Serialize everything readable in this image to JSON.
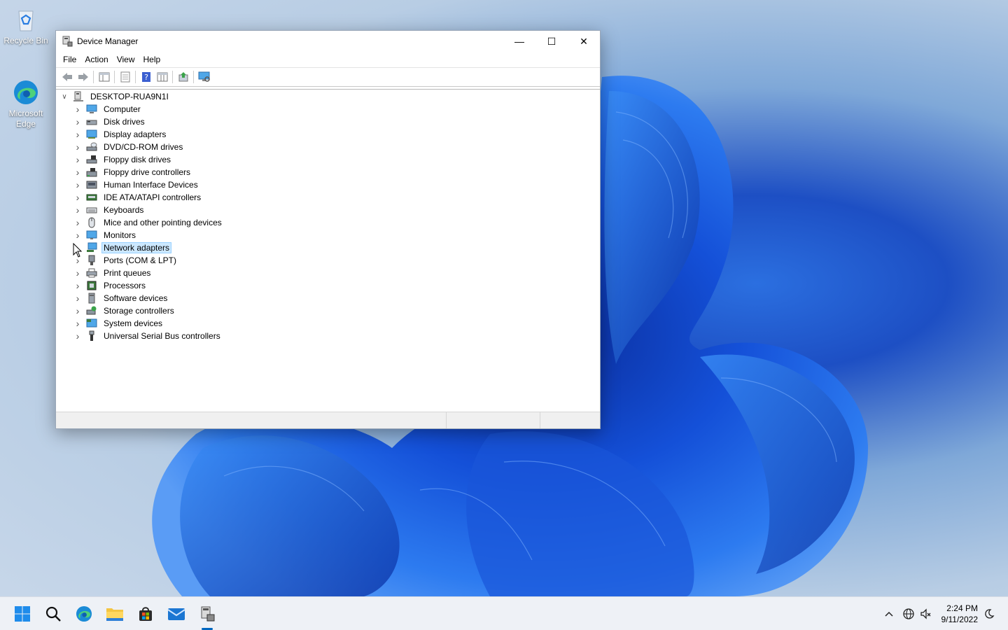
{
  "desktop": {
    "icons": [
      {
        "label": "Recycle Bin",
        "icon": "recycle-bin-icon"
      },
      {
        "label": "Microsoft Edge",
        "icon": "edge-icon"
      }
    ]
  },
  "window": {
    "title": "Device Manager",
    "controls": {
      "minimize": "—",
      "maximize": "☐",
      "close": "✕"
    },
    "menu": [
      "File",
      "Action",
      "View",
      "Help"
    ],
    "toolbar": [
      "back-icon",
      "forward-icon",
      "show-hide-console-tree-icon",
      "properties-icon",
      "help-icon",
      "console-tree-view-icon",
      "update-driver-icon",
      "scan-hardware-icon"
    ],
    "tree": {
      "root": "DESKTOP-RUA9N1I",
      "items": [
        {
          "label": "Computer",
          "icon": "computer-icon"
        },
        {
          "label": "Disk drives",
          "icon": "disk-drive-icon"
        },
        {
          "label": "Display adapters",
          "icon": "display-adapter-icon"
        },
        {
          "label": "DVD/CD-ROM drives",
          "icon": "dvd-drive-icon"
        },
        {
          "label": "Floppy disk drives",
          "icon": "floppy-disk-icon"
        },
        {
          "label": "Floppy drive controllers",
          "icon": "floppy-controller-icon"
        },
        {
          "label": "Human Interface Devices",
          "icon": "hid-icon"
        },
        {
          "label": "IDE ATA/ATAPI controllers",
          "icon": "ide-controller-icon"
        },
        {
          "label": "Keyboards",
          "icon": "keyboard-icon"
        },
        {
          "label": "Mice and other pointing devices",
          "icon": "mouse-icon"
        },
        {
          "label": "Monitors",
          "icon": "monitor-icon"
        },
        {
          "label": "Network adapters",
          "icon": "network-adapter-icon",
          "selected": true
        },
        {
          "label": "Ports (COM & LPT)",
          "icon": "port-icon"
        },
        {
          "label": "Print queues",
          "icon": "printer-icon"
        },
        {
          "label": "Processors",
          "icon": "processor-icon"
        },
        {
          "label": "Software devices",
          "icon": "software-device-icon"
        },
        {
          "label": "Storage controllers",
          "icon": "storage-controller-icon"
        },
        {
          "label": "System devices",
          "icon": "system-device-icon"
        },
        {
          "label": "Universal Serial Bus controllers",
          "icon": "usb-icon"
        }
      ]
    }
  },
  "taskbar": {
    "apps": [
      "start-icon",
      "search-icon",
      "edge-icon",
      "file-explorer-icon",
      "store-icon",
      "mail-icon",
      "device-manager-icon"
    ],
    "tray": [
      "chevron-up-icon",
      "network-icon",
      "volume-icon"
    ],
    "time": "2:24 PM",
    "date": "9/11/2022"
  }
}
